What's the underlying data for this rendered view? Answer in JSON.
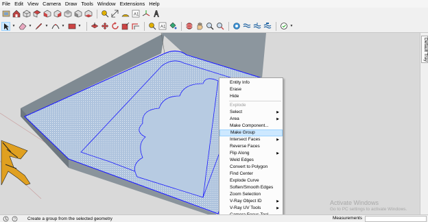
{
  "menu": [
    "File",
    "Edit",
    "View",
    "Camera",
    "Draw",
    "Tools",
    "Window",
    "Extensions",
    "Help"
  ],
  "tray": {
    "label": "Default Tray"
  },
  "context_menu": [
    {
      "label": "Entity Info",
      "state": "normal"
    },
    {
      "label": "Erase",
      "state": "normal"
    },
    {
      "label": "Hide",
      "state": "normal"
    },
    {
      "sep": true
    },
    {
      "label": "Explode",
      "state": "disabled"
    },
    {
      "label": "Select",
      "state": "normal",
      "submenu": true
    },
    {
      "label": "Area",
      "state": "normal",
      "submenu": true
    },
    {
      "label": "Make Component...",
      "state": "normal"
    },
    {
      "label": "Make Group",
      "state": "highlighted"
    },
    {
      "label": "Intersect Faces",
      "state": "normal",
      "submenu": true
    },
    {
      "label": "Reverse Faces",
      "state": "normal"
    },
    {
      "label": "Flip Along",
      "state": "normal",
      "submenu": true
    },
    {
      "label": "Weld Edges",
      "state": "normal"
    },
    {
      "label": "Convert to Polygon",
      "state": "normal"
    },
    {
      "label": "Find Center",
      "state": "normal"
    },
    {
      "label": "Explode Curve",
      "state": "normal"
    },
    {
      "label": "Soften/Smooth Edges",
      "state": "normal"
    },
    {
      "label": "Zoom Selection",
      "state": "normal"
    },
    {
      "label": "V-Ray Object ID",
      "state": "normal",
      "submenu": true
    },
    {
      "label": "V-Ray UV Tools",
      "state": "normal",
      "submenu": true
    },
    {
      "label": "Camera Focus Tool",
      "state": "normal"
    }
  ],
  "watermark": {
    "title": "Activate Windows",
    "subtitle": "Go to PC settings to activate Windows."
  },
  "status": {
    "message": "Create a group from the selected geometry",
    "measurements_label": "Measurements",
    "measurements_value": ""
  },
  "colors": {
    "selection": "#1a1aff",
    "face": "#aec3dd",
    "wall": "#8a949c",
    "floor_bg": "#d9d9d9",
    "highlight": "#cde8ff"
  }
}
